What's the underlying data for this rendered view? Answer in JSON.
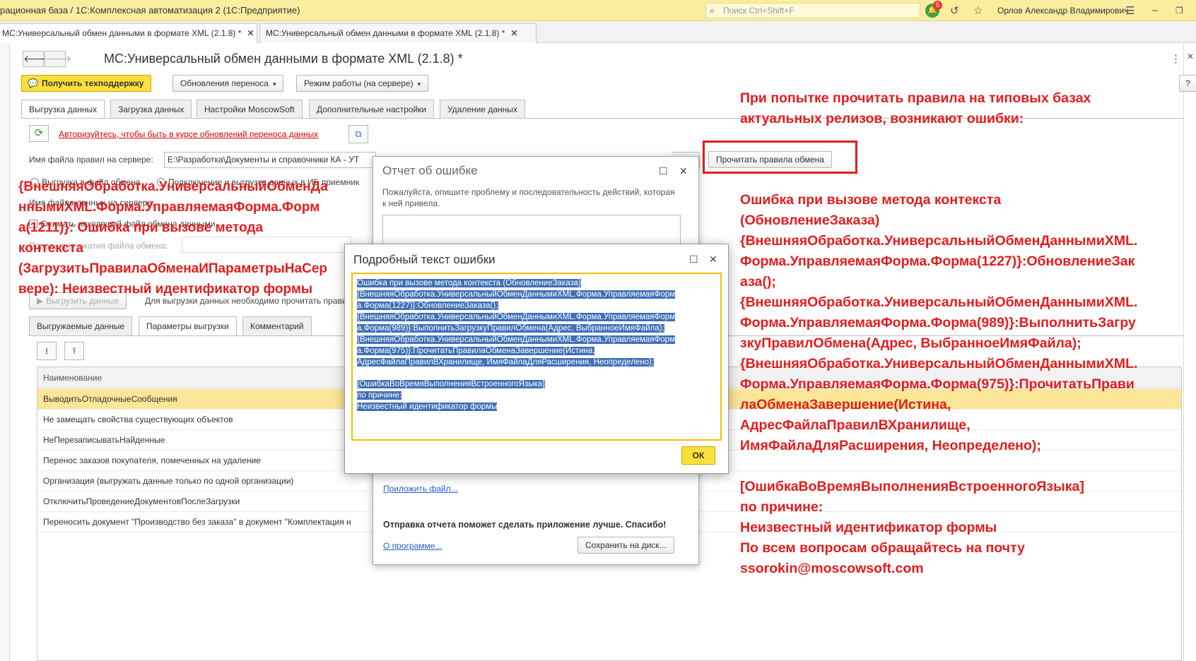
{
  "window": {
    "title": "рационная база / 1С:Комплексная автоматизация 2  (1С:Предприятие)",
    "search_placeholder": "Поиск Ctrl+Shift+F",
    "notification_count": "5",
    "user": "Орлов Александр Владимирович"
  },
  "window_tabs": [
    {
      "label": "МС:Универсальный обмен данными в формате XML (2.1.8) *",
      "close": "✕"
    },
    {
      "label": "МС:Универсальный обмен данными в формате XML (2.1.8) *",
      "close": "✕"
    }
  ],
  "form": {
    "title": "МС:Универсальный обмен данными в формате XML (2.1.8) *",
    "support_button": "Получить техподдержку",
    "updates_button": "Обновления переноса",
    "mode_button": "Режим работы (на сервере)",
    "help_button": "?",
    "tabs": [
      "Выгрузка данных",
      "Загрузка данных",
      "Настройки MoscowSoft",
      "Дополнительные настройки",
      "Удаление данных"
    ],
    "auth_link": "Авторизуйтесь, чтобы быть в курсе обновлений переноса данных",
    "rules_label": "Имя файла правил на сервере:",
    "rules_path": "E:\\Разработка\\Документы и справочники КА - УТ",
    "read_rules_button": "Прочитать правила обмена",
    "radio_file": "Выгрузка в файл обмена",
    "radio_ib": "Подключение и выгрузка данных в ИБ приемник",
    "data_file_label": "Имя файла данных на сервере:",
    "compress_label": "Сжимать исходящий файл обмена данными",
    "password_label": "Пароль для сжатия файла обмена:",
    "export_button": "Выгрузить данные",
    "export_hint": "Для выгрузки данных необходимо прочитать правила",
    "bottom_tabs": [
      "Выгружаемые данные",
      "Параметры выгрузки",
      "Комментарий"
    ],
    "table_header": "Наименование",
    "table_rows": [
      "ВыводитьОтладочныеСообщения",
      "Не замещать свойства существующих объектов",
      "НеПерезаписыватьНайденные",
      "Перенос заказов покупателя, помеченных на удаление",
      "Организация (выгружать данные только по одной организации)",
      "ОтключитьПроведениеДокументовПослеЗагрузки",
      "Переносить документ \"Производство без заказа\" в документ \"Комплектация н"
    ]
  },
  "report_dialog": {
    "title": "Отчет об ошибке",
    "description": "Пожалуйста, опишите проблему и последовательность действий, которая к ней привела.",
    "attach_link": "Приложить файл...",
    "thanks": "Отправка отчета поможет сделать приложение лучше. Спасибо!",
    "about_link": "О программе...",
    "save_button": "Сохранить на диск..."
  },
  "detail_dialog": {
    "title": "Подробный текст ошибки",
    "lines": [
      "Ошибка при вызове метода контекста (ОбновлениеЗаказа)",
      "{ВнешняяОбработка.УниверсальныйОбменДаннымиXML.Форма.УправляемаяФорм",
      "а.Форма(1227)}:ОбновлениеЗаказа();",
      "{ВнешняяОбработка.УниверсальныйОбменДаннымиXML.Форма.УправляемаяФорм",
      "а.Форма(989)}:ВыполнитьЗагрузкуПравилОбмена(Адрес, ВыбранноеИмяФайла);",
      "{ВнешняяОбработка.УниверсальныйОбменДаннымиXML.Форма.УправляемаяФорм",
      "а.Форма(975)}:ПрочитатьПравилаОбменаЗавершение(Истина,",
      "АдресФайлаПравилВХранилище, ИмяФайлаДляРасширения, Неопределено);",
      "",
      "[ОшибкаВоВремяВыполненияВстроенногоЯзыка]",
      "по причине:",
      "Неизвестный идентификатор формы"
    ],
    "ok_button": "ОК"
  },
  "annotations": {
    "top": [
      "При попытке прочитать правила на типовых базах",
      "актуальных релизов, возникают ошибки:"
    ],
    "left": [
      "{ВнешняяОбработка.УниверсальныйОбменДа",
      "ннымиXML.Форма.УправляемаяФорма.Форм",
      "а(1211)}: Ошибка при вызове метода",
      "контекста",
      "(ЗагрузитьПравилаОбменаИПараметрыНаСер",
      "вере): Неизвестный идентификатор формы"
    ],
    "right": [
      "Ошибка при вызове метода контекста",
      "(ОбновлениеЗаказа)",
      "{ВнешняяОбработка.УниверсальныйОбменДаннымиXML.",
      "Форма.УправляемаяФорма.Форма(1227)}:ОбновлениеЗак",
      "аза();",
      "{ВнешняяОбработка.УниверсальныйОбменДаннымиXML.",
      "Форма.УправляемаяФорма.Форма(989)}:ВыполнитьЗагру",
      "зкуПравилОбмена(Адрес, ВыбранноеИмяФайла);",
      "{ВнешняяОбработка.УниверсальныйОбменДаннымиXML.",
      "Форма.УправляемаяФорма.Форма(975)}:ПрочитатьПрави",
      "лаОбменаЗавершение(Истина,",
      "АдресФайлаПравилВХранилище,",
      "ИмяФайлаДляРасширения, Неопределено);",
      "",
      "[ОшибкаВоВремяВыполненияВстроенногоЯзыка]",
      "по причине:",
      "Неизвестный идентификатор формы",
      "По всем вопросам обращайтесь на почту",
      "ssorokin@moscowsoft.com"
    ]
  },
  "colors": {
    "accent_yellow": "#fbe03b",
    "title_bar": "#fbed9e",
    "annotation_red": "#e51c1c",
    "selection_blue": "#3f6fb6",
    "selected_row": "#fbe596"
  }
}
